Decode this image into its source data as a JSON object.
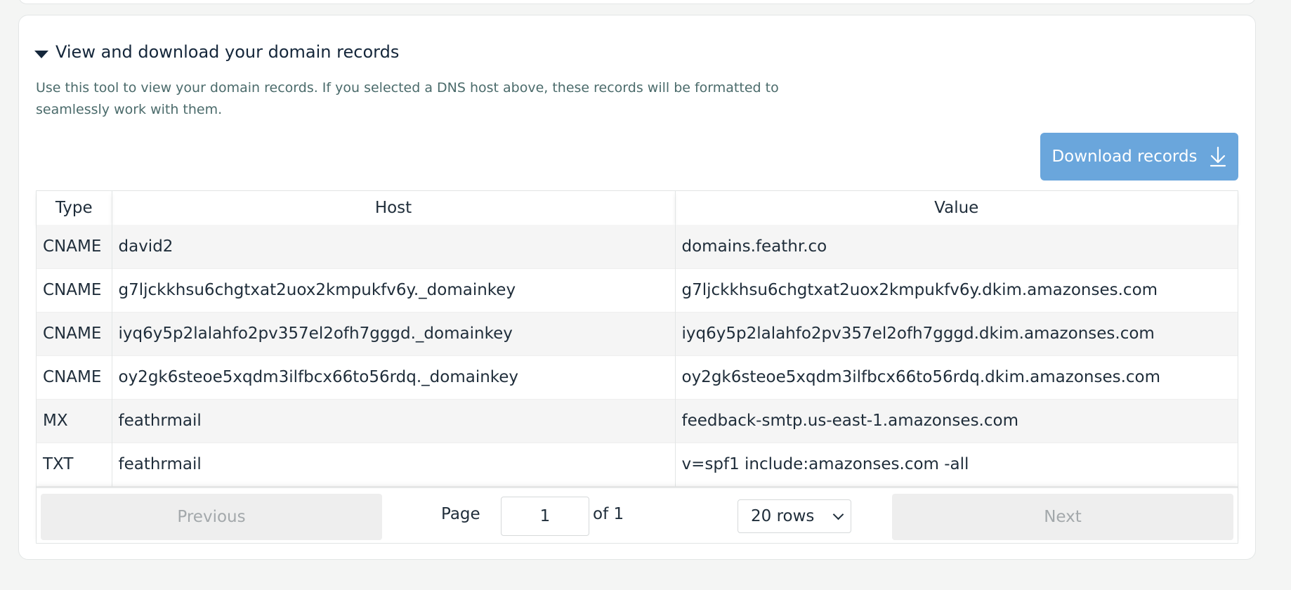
{
  "section": {
    "title": "View and download your domain records",
    "description": "Use this tool to view your domain records. If you selected a DNS host above, these records will be formatted to seamlessly work with them."
  },
  "download_button": {
    "label": "Download records",
    "icon": "download-arrow-icon"
  },
  "table": {
    "headers": [
      "Type",
      "Host",
      "Value"
    ],
    "rows": [
      {
        "type": "CNAME",
        "host": "david2",
        "value": "domains.feathr.co"
      },
      {
        "type": "CNAME",
        "host": "g7ljckkhsu6chgtxat2uox2kmpukfv6y._domainkey",
        "value": "g7ljckkhsu6chgtxat2uox2kmpukfv6y.dkim.amazonses.com"
      },
      {
        "type": "CNAME",
        "host": "iyq6y5p2lalahfo2pv357el2ofh7gggd._domainkey",
        "value": "iyq6y5p2lalahfo2pv357el2ofh7gggd.dkim.amazonses.com"
      },
      {
        "type": "CNAME",
        "host": "oy2gk6steoe5xqdm3ilfbcx66to56rdq._domainkey",
        "value": "oy2gk6steoe5xqdm3ilfbcx66to56rdq.dkim.amazonses.com"
      },
      {
        "type": "MX",
        "host": "feathrmail",
        "value": "feedback-smtp.us-east-1.amazonses.com"
      },
      {
        "type": "TXT",
        "host": "feathrmail",
        "value": "v=spf1 include:amazonses.com -all"
      }
    ]
  },
  "pagination": {
    "previous_label": "Previous",
    "next_label": "Next",
    "page_label": "Page",
    "page_value": "1",
    "of_label": "of 1",
    "rows_label": "20 rows"
  },
  "colors": {
    "accent": "#6aa6dc",
    "title": "#14263a",
    "description": "#4b6b6b"
  }
}
